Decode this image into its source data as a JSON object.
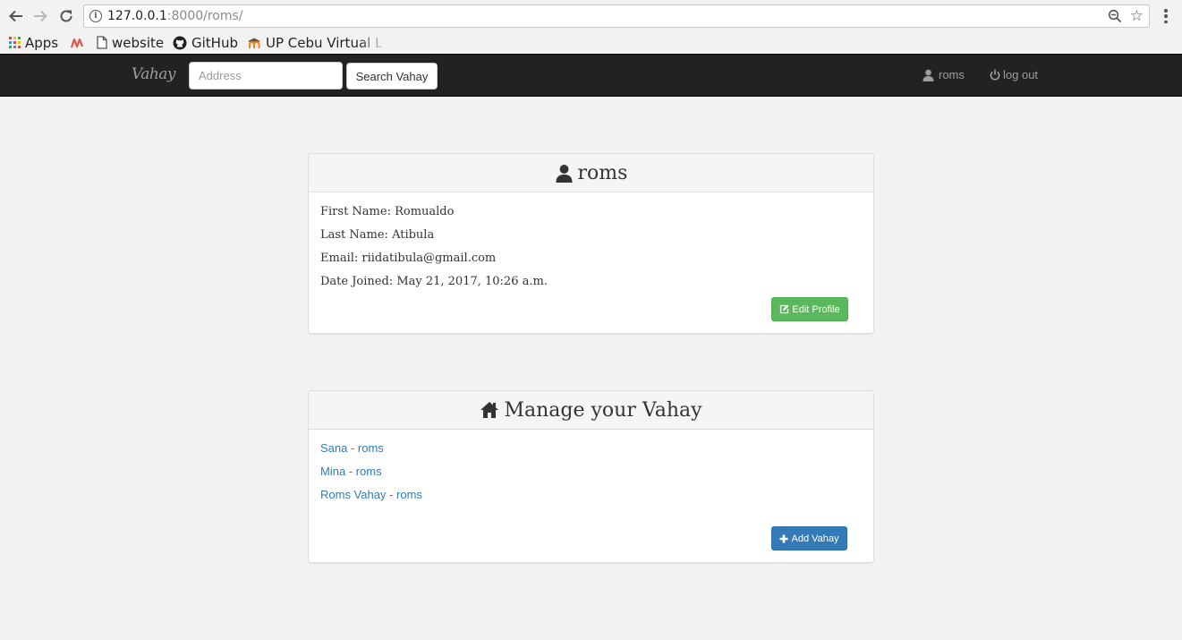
{
  "browser": {
    "url_host": "127.0.0.1",
    "url_rest": ":8000/roms/",
    "bookmarks": [
      {
        "label": "Apps",
        "icon": "apps-grid-icon"
      },
      {
        "label": "",
        "icon": "m-logo-icon"
      },
      {
        "label": "website",
        "icon": "page-icon"
      },
      {
        "label": "GitHub",
        "icon": "github-icon"
      },
      {
        "label": "UP Cebu Virtual L",
        "icon": "moodle-icon"
      }
    ]
  },
  "navbar": {
    "brand": "Vahay",
    "search_placeholder": "Address",
    "search_button": "Search Vahay",
    "user_link": "roms",
    "logout_link": "log out"
  },
  "profile": {
    "title": "roms",
    "first_name": "First Name: Romualdo",
    "last_name": "Last Name: Atibula",
    "email": "Email: riidatibula@gmail.com",
    "date_joined": "Date Joined: May 21, 2017, 10:26 a.m.",
    "edit_button": "Edit Profile"
  },
  "manage": {
    "title": "Manage your Vahay",
    "items": [
      {
        "label": "Sana - roms"
      },
      {
        "label": "Mina - roms"
      },
      {
        "label": "Roms Vahay - roms"
      }
    ],
    "add_button": "Add Vahay"
  },
  "colors": {
    "navbar_bg": "#222222",
    "link": "#337ab7",
    "success": "#5cb85c",
    "primary": "#337ab7",
    "page_bg": "#f2f2f2"
  }
}
